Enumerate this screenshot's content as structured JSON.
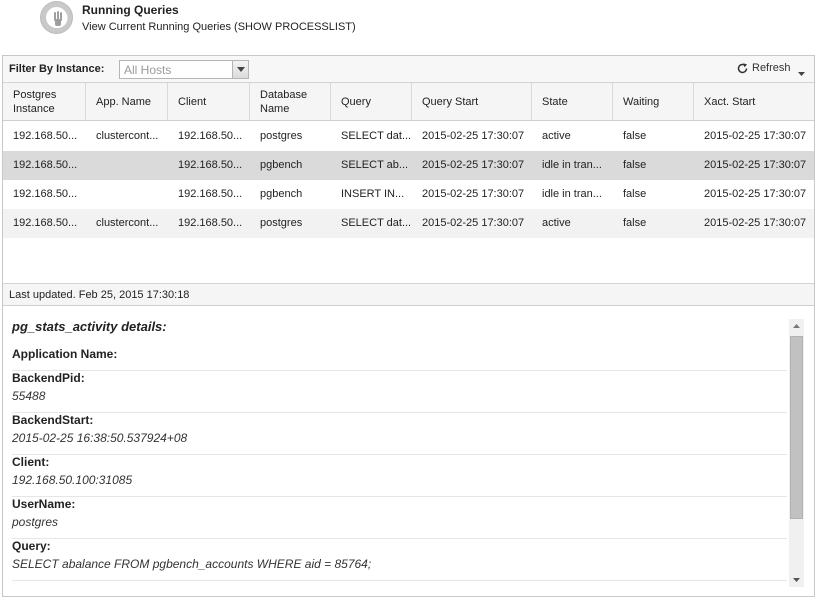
{
  "header": {
    "title": "Running Queries",
    "subtitle": "View Current Running Queries (SHOW PROCESSLIST)",
    "icon": "running-queries-icon"
  },
  "toolbar": {
    "filter_label": "Filter By Instance:",
    "filter_value": "All Hosts",
    "refresh_label": "Refresh"
  },
  "grid": {
    "columns": [
      "Postgres Instance",
      "App. Name",
      "Client",
      "Database Name",
      "Query",
      "Query Start",
      "State",
      "Waiting",
      "Xact. Start"
    ],
    "rows": [
      [
        "192.168.50...",
        "clustercont...",
        "192.168.50...",
        "postgres",
        "SELECT dat...",
        "2015-02-25 17:30:07",
        "active",
        "false",
        "2015-02-25 17:30:07"
      ],
      [
        "192.168.50...",
        "",
        "192.168.50...",
        "pgbench",
        "SELECT ab...",
        "2015-02-25 17:30:07",
        "idle in tran...",
        "false",
        "2015-02-25 17:30:07"
      ],
      [
        "192.168.50...",
        "",
        "192.168.50...",
        "pgbench",
        "INSERT IN...",
        "2015-02-25 17:30:07",
        "idle in tran...",
        "false",
        "2015-02-25 17:30:07"
      ],
      [
        "192.168.50...",
        "clustercont...",
        "192.168.50...",
        "postgres",
        "SELECT dat...",
        "2015-02-25 17:30:07",
        "active",
        "false",
        "2015-02-25 17:30:07"
      ]
    ],
    "selected_row": 1
  },
  "status": {
    "text": "Last updated. Feb 25, 2015 17:30:18"
  },
  "details": {
    "title": "pg_stats_activity details:",
    "fields": [
      {
        "label": "Application Name:",
        "value": ""
      },
      {
        "label": "BackendPid:",
        "value": "55488"
      },
      {
        "label": "BackendStart:",
        "value": "2015-02-25 16:38:50.537924+08"
      },
      {
        "label": "Client:",
        "value": "192.168.50.100:31085"
      },
      {
        "label": "UserName:",
        "value": "postgres"
      },
      {
        "label": "Query:",
        "value": "SELECT abalance FROM pgbench_accounts WHERE aid = 85764;"
      }
    ]
  },
  "colors": {
    "selected_row": "#dadada",
    "alt_row": "#f2f2f2",
    "header_bg": "#f5f5f5"
  }
}
